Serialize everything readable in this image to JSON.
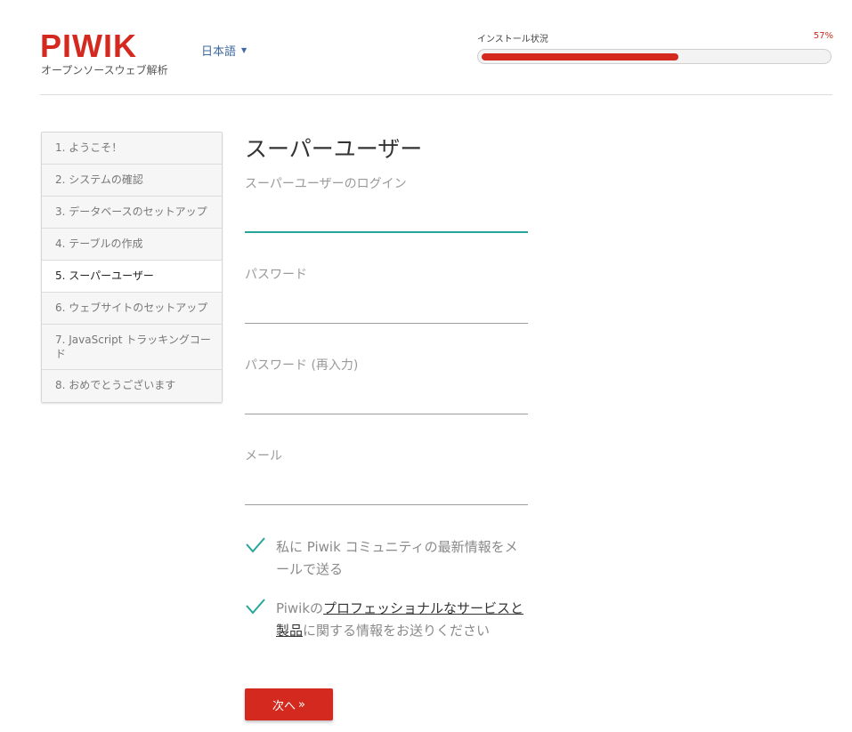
{
  "header": {
    "logo": "PIWIK",
    "tagline": "オープンソースウェブ解析",
    "language": "日本語",
    "progress_label": "インストール状況",
    "progress_percent_text": "57%",
    "progress_value": 57
  },
  "steps": [
    {
      "label": "1. ようこそ！"
    },
    {
      "label": "2. システムの確認"
    },
    {
      "label": "3. データベースのセットアップ"
    },
    {
      "label": "4. テーブルの作成"
    },
    {
      "label": "5. スーパーユーザー"
    },
    {
      "label": "6. ウェブサイトのセットアップ"
    },
    {
      "label": "7. JavaScript トラッキングコード"
    },
    {
      "label": "8. おめでとうございます"
    }
  ],
  "current_step": 5,
  "form": {
    "title": "スーパーユーザー",
    "login_label": "スーパーユーザーのログイン",
    "login_value": "",
    "password_label": "パスワード",
    "password_value": "",
    "password_repeat_label": "パスワード (再入力)",
    "password_repeat_value": "",
    "email_label": "メール",
    "email_value": "",
    "newsletter_label": "私に Piwik コミュニティの最新情報をメールで送る",
    "pro_prefix": "Piwikの",
    "pro_link": "プロフェッショナルなサービスと製品",
    "pro_suffix": "に関する情報をお送りください",
    "next_label": "次へ",
    "next_arrow": "»"
  },
  "colors": {
    "brand": "#d4291f",
    "accent": "#26a69a",
    "link": "#3f6aa0"
  },
  "icons": {
    "language_caret": "caret-down-icon",
    "check": "checkmark-icon"
  }
}
